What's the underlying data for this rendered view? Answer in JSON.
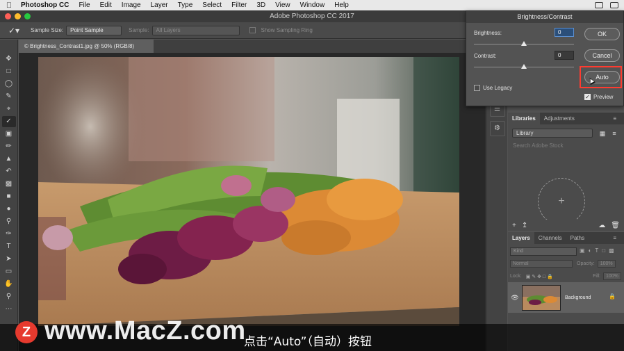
{
  "menubar": {
    "apple": "",
    "app_name": "Photoshop CC",
    "items": [
      "File",
      "Edit",
      "Image",
      "Layer",
      "Type",
      "Select",
      "Filter",
      "3D",
      "View",
      "Window",
      "Help"
    ]
  },
  "titlebar": {
    "title": "Adobe Photoshop CC 2017"
  },
  "options": {
    "sample_size_label": "Sample Size:",
    "sample_size_value": "Point Sample",
    "sample_label": "Sample:",
    "sample_value": "All Layers",
    "sampling_ring_label": "Show Sampling Ring"
  },
  "document": {
    "tab_close": "×",
    "tab_title": "© Brightness_Contrast1.jpg @ 50% (RGB/8)"
  },
  "dialog": {
    "title": "Brightness/Contrast",
    "brightness_label": "Brightness:",
    "brightness_value": "0",
    "contrast_label": "Contrast:",
    "contrast_value": "0",
    "ok_label": "OK",
    "cancel_label": "Cancel",
    "auto_label": "Auto",
    "use_legacy_label": "Use Legacy",
    "use_legacy_checked": false,
    "preview_label": "Preview",
    "preview_checked": true
  },
  "libraries_panel": {
    "tabs": [
      "Libraries",
      "Adjustments"
    ],
    "active_tab": "Libraries",
    "library_select": "Library",
    "search_placeholder": "Search Adobe Stock",
    "drop_plus": "+"
  },
  "layers_panel": {
    "tabs": [
      "Layers",
      "Channels",
      "Paths"
    ],
    "active_tab": "Layers",
    "kind_placeholder": "Kind",
    "blend_mode": "Normal",
    "opacity_label": "Opacity:",
    "opacity_value": "100%",
    "lock_label": "Lock:",
    "fill_label": "Fill:",
    "fill_value": "100%",
    "layer_name": "Background"
  },
  "overlay": {
    "watermark_logo": "Z",
    "watermark_text": "www.MacZ.com",
    "subtitle": "点击“Auto”（自动）按钮"
  },
  "colors": {
    "menubar_bg": "#e8e8e8",
    "app_bg": "#535353",
    "highlight_red": "#ff3b30",
    "watermark_red": "#e63a2e"
  }
}
